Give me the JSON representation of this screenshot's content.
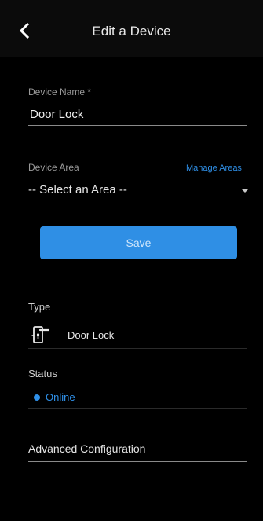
{
  "header": {
    "title": "Edit a Device"
  },
  "form": {
    "device_name_label": "Device Name *",
    "device_name_value": "Door Lock",
    "device_area_label": "Device Area",
    "manage_areas_label": "Manage Areas",
    "area_select_value": "-- Select an Area --",
    "save_label": "Save"
  },
  "details": {
    "type_label": "Type",
    "type_value": "Door Lock",
    "type_icon": "door-lock-icon",
    "status_label": "Status",
    "status_value": "Online",
    "status_color": "#2f90e8"
  },
  "advanced": {
    "label": "Advanced Configuration"
  },
  "colors": {
    "accent": "#2f8fe5",
    "background": "#000000"
  }
}
